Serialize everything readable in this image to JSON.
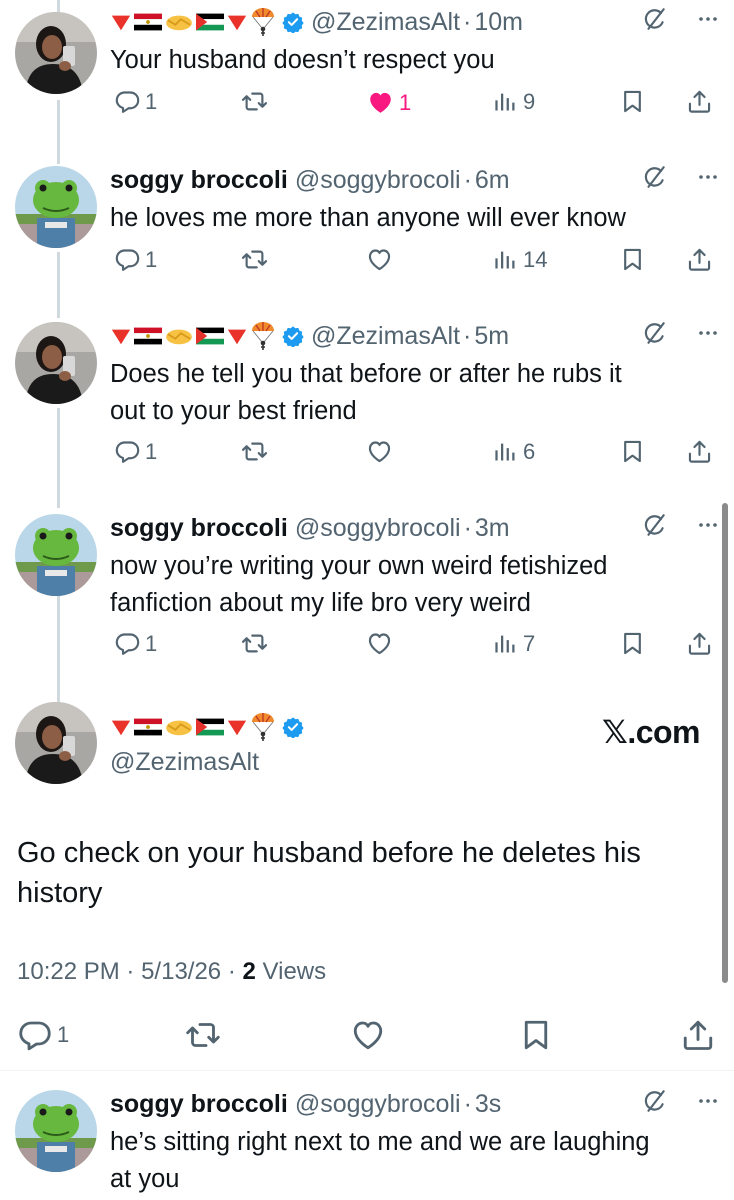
{
  "colors": {
    "text": "#0f1419",
    "secondary": "#536471",
    "like_pink": "#f91880",
    "verified_blue": "#1d9bf0",
    "thread_line": "#cfd9de"
  },
  "users": {
    "zezimas": {
      "handle": "@ZezimasAlt",
      "name_emoji": [
        "red-triangle-icon",
        "egypt-flag-icon",
        "handshake-icon",
        "palestine-flag-icon",
        "red-triangle-icon",
        "parachute-icon"
      ],
      "verified": true
    },
    "soggy": {
      "name": "soggy broccoli",
      "handle": "@soggybrocoli"
    }
  },
  "replies": [
    {
      "author": "zezimas",
      "handle": "@ZezimasAlt",
      "time": "10m",
      "text": "Your husband doesn’t respect you",
      "replies": "1",
      "likes": "1",
      "liked": true,
      "views": "9"
    },
    {
      "author": "soggy",
      "name": "soggy broccoli",
      "handle": "@soggybrocoli",
      "time": "6m",
      "text": "he loves me more than anyone will ever know",
      "replies": "1",
      "views": "14"
    },
    {
      "author": "zezimas",
      "handle": "@ZezimasAlt",
      "time": "5m",
      "text_lines": [
        "Does he tell you that before or after he rubs it",
        "out to your best friend"
      ],
      "replies": "1",
      "views": "6"
    },
    {
      "author": "soggy",
      "name": "soggy broccoli",
      "handle": "@soggybrocoli",
      "time": "3m",
      "text_lines": [
        "now you’re writing your own weird fetishized",
        "fanfiction about my life bro very weird"
      ],
      "replies": "1",
      "views": "7"
    }
  ],
  "main_post": {
    "handle": "@ZezimasAlt",
    "watermark": "𝕏.com",
    "text_lines": [
      "Go check on your husband before he deletes his",
      "history"
    ],
    "time": "10:22 PM",
    "date": "5/13/26",
    "views_count": "2",
    "views_label": "Views",
    "replies": "1"
  },
  "last_reply": {
    "name": "soggy broccoli",
    "handle": "@soggybrocoli",
    "time": "3s",
    "text_lines": [
      "he’s sitting right next to me and we are laughing",
      "at you"
    ]
  },
  "separator": "·"
}
